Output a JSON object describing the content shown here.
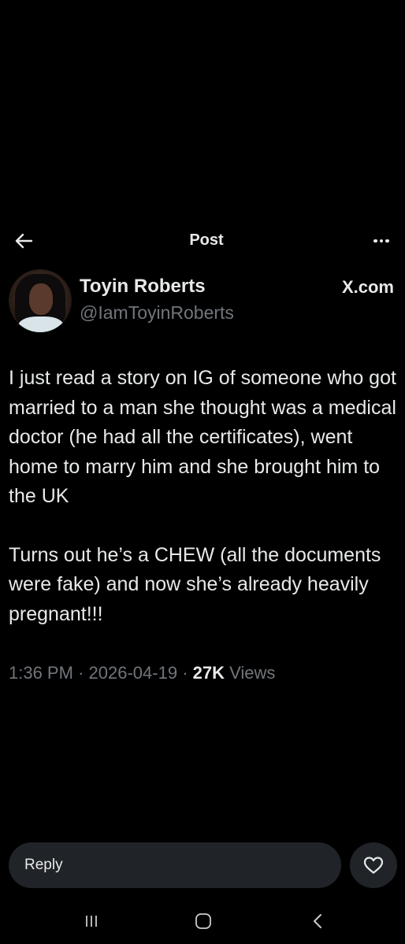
{
  "header": {
    "back_icon": "arrow-left-icon",
    "title": "Post",
    "more_icon": "more-horizontal-icon"
  },
  "author": {
    "display_name": "Toyin Roberts",
    "handle": "@IamToyinRoberts",
    "source_label": "X.com"
  },
  "tweet": {
    "paragraphs": [
      "I just read a story on IG of someone who got married to a man she thought was a medical doctor (he had all the certificates), went home to marry him and she brought him to the UK",
      "Turns out he’s a CHEW (all the documents were fake) and now she’s already heavily pregnant!!!"
    ],
    "time": "1:36 PM",
    "separator": "·",
    "date": "2026-04-19",
    "views_count": "27K",
    "views_label": "Views"
  },
  "composer": {
    "reply_placeholder": "Reply",
    "like_icon": "heart-icon"
  },
  "system_nav": {
    "recents_icon": "recents-icon",
    "home_icon": "home-icon",
    "back_icon": "chevron-left-icon"
  },
  "colors": {
    "background": "#000000",
    "text_primary": "#e7e9ea",
    "text_secondary": "#71767b",
    "input_background": "#202327"
  }
}
